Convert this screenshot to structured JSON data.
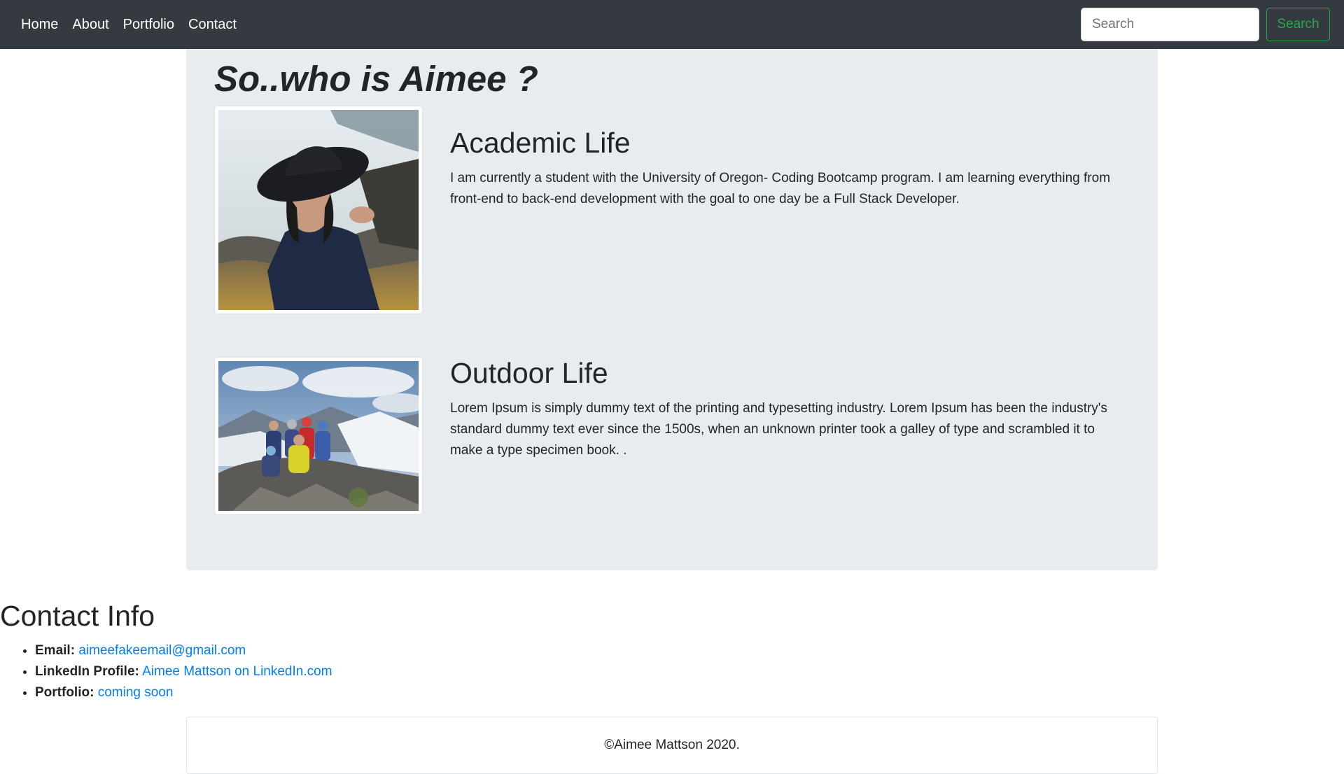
{
  "nav": {
    "links": [
      "Home",
      "About",
      "Portfolio",
      "Contact"
    ],
    "search_placeholder": "Search",
    "search_button": "Search"
  },
  "about": {
    "title": "So..who is Aimee ?",
    "sections": [
      {
        "heading": "Academic Life",
        "text": "I am currently a student with the University of Oregon- Coding Bootcamp program. I am learning everything from front-end to back-end development with the goal to one day be a Full Stack Developer."
      },
      {
        "heading": "Outdoor Life",
        "text": "Lorem Ipsum is simply dummy text of the printing and typesetting industry. Lorem Ipsum has been the industry's standard dummy text ever since the 1500s, when an unknown printer took a galley of type and scrambled it to make a type specimen book. ."
      }
    ]
  },
  "contact": {
    "title": "Contact Info",
    "items": [
      {
        "label": "Email:",
        "value": "aimeefakeemail@gmail.com"
      },
      {
        "label": "LinkedIn Profile:",
        "value": "Aimee Mattson on LinkedIn.com"
      },
      {
        "label": "Portfolio:",
        "value": "coming soon"
      }
    ]
  },
  "footer": {
    "text": "©Aimee Mattson 2020."
  },
  "colors": {
    "navbar_bg": "#343a40",
    "jumbotron_bg": "#e9ecef",
    "link": "#007bff",
    "success": "#28a745"
  }
}
